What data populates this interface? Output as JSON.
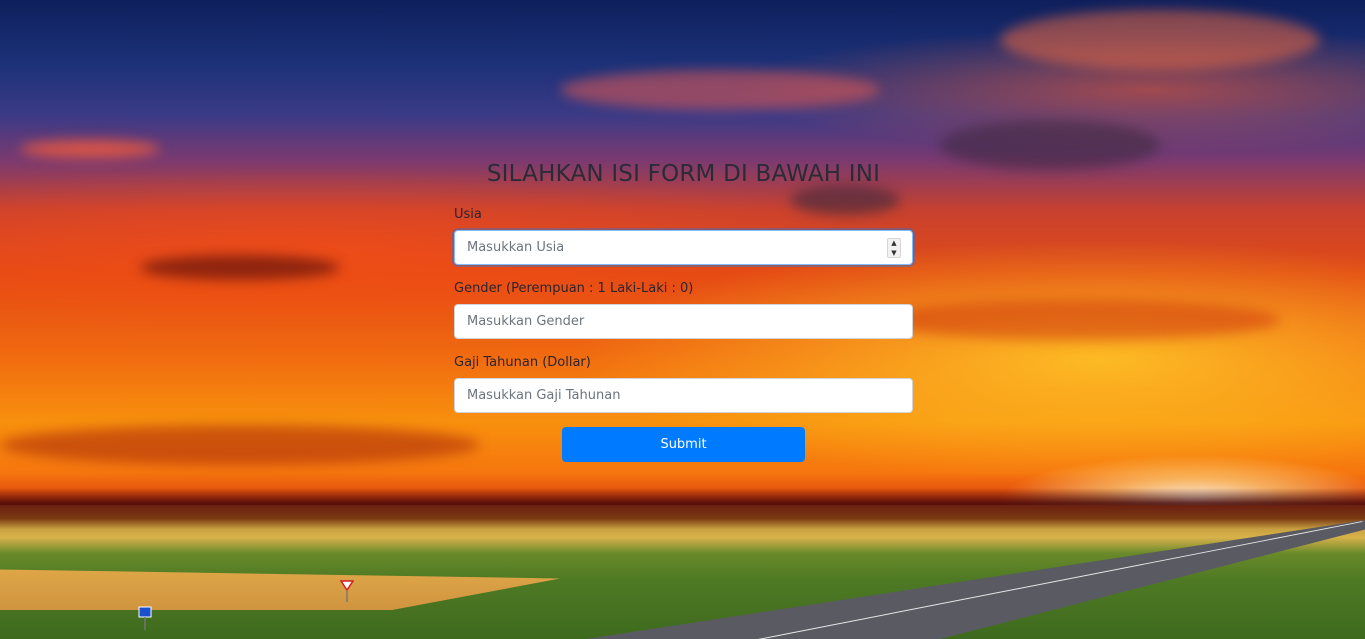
{
  "form": {
    "title": "SILAHKAN ISI FORM DI BAWAH INI",
    "fields": [
      {
        "label": "Usia",
        "placeholder": "Masukkan Usia",
        "type": "number"
      },
      {
        "label": "Gender (Perempuan : 1 Laki-Laki : 0)",
        "placeholder": "Masukkan Gender",
        "type": "text"
      },
      {
        "label": "Gaji Tahunan (Dollar)",
        "placeholder": "Masukkan Gaji Tahunan",
        "type": "text"
      }
    ],
    "submit_label": "Submit"
  },
  "theme": {
    "button_color": "#007bff",
    "focus_color": "#80bdff",
    "background": "sunset-landscape-photo"
  },
  "icons": {
    "number_spinner": "up-down-arrows-icon"
  }
}
